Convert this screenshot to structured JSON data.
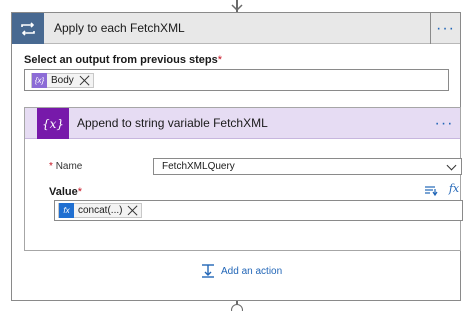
{
  "foreach": {
    "title": "Apply to each FetchXML",
    "menu_icon": "ellipsis-icon",
    "select_label": "Select an output from previous steps",
    "required_mark": "*",
    "token": {
      "icon_text": "{x}",
      "label": "Body",
      "color": "#8c6cd6"
    }
  },
  "append": {
    "icon_text": "{x}",
    "title": "Append to string variable FetchXML",
    "accent_color": "#7719aa",
    "name_label": "Name",
    "name_required_mark": "*",
    "name_value": "FetchXMLQuery",
    "value_label": "Value",
    "value_required_mark": "*",
    "fx_text": "fx",
    "token": {
      "icon_text": "fx",
      "label": "concat(...)",
      "color": "#1f6fd1"
    }
  },
  "add_action": {
    "label": "Add an action"
  },
  "colors": {
    "link": "#2266b7",
    "loop_header": "#486991"
  }
}
